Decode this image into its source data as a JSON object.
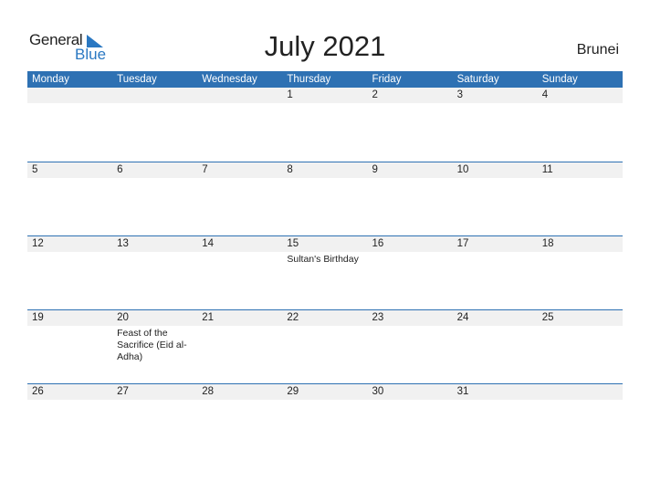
{
  "logo": {
    "word1": "General",
    "word2": "Blue"
  },
  "title": "July 2021",
  "country": "Brunei",
  "colors": {
    "header_bg": "#2e71b3",
    "date_strip": "#f1f1f1",
    "logo_blue": "#2a78c2"
  },
  "weekdays": [
    "Monday",
    "Tuesday",
    "Wednesday",
    "Thursday",
    "Friday",
    "Saturday",
    "Sunday"
  ],
  "weeks": [
    [
      {
        "date": ""
      },
      {
        "date": ""
      },
      {
        "date": ""
      },
      {
        "date": "1"
      },
      {
        "date": "2"
      },
      {
        "date": "3"
      },
      {
        "date": "4"
      }
    ],
    [
      {
        "date": "5"
      },
      {
        "date": "6"
      },
      {
        "date": "7"
      },
      {
        "date": "8"
      },
      {
        "date": "9"
      },
      {
        "date": "10"
      },
      {
        "date": "11"
      }
    ],
    [
      {
        "date": "12"
      },
      {
        "date": "13"
      },
      {
        "date": "14"
      },
      {
        "date": "15",
        "event": "Sultan's Birthday"
      },
      {
        "date": "16"
      },
      {
        "date": "17"
      },
      {
        "date": "18"
      }
    ],
    [
      {
        "date": "19"
      },
      {
        "date": "20",
        "event": "Feast of the Sacrifice (Eid al-Adha)"
      },
      {
        "date": "21"
      },
      {
        "date": "22"
      },
      {
        "date": "23"
      },
      {
        "date": "24"
      },
      {
        "date": "25"
      }
    ],
    [
      {
        "date": "26"
      },
      {
        "date": "27"
      },
      {
        "date": "28"
      },
      {
        "date": "29"
      },
      {
        "date": "30"
      },
      {
        "date": "31"
      },
      {
        "date": ""
      }
    ]
  ]
}
